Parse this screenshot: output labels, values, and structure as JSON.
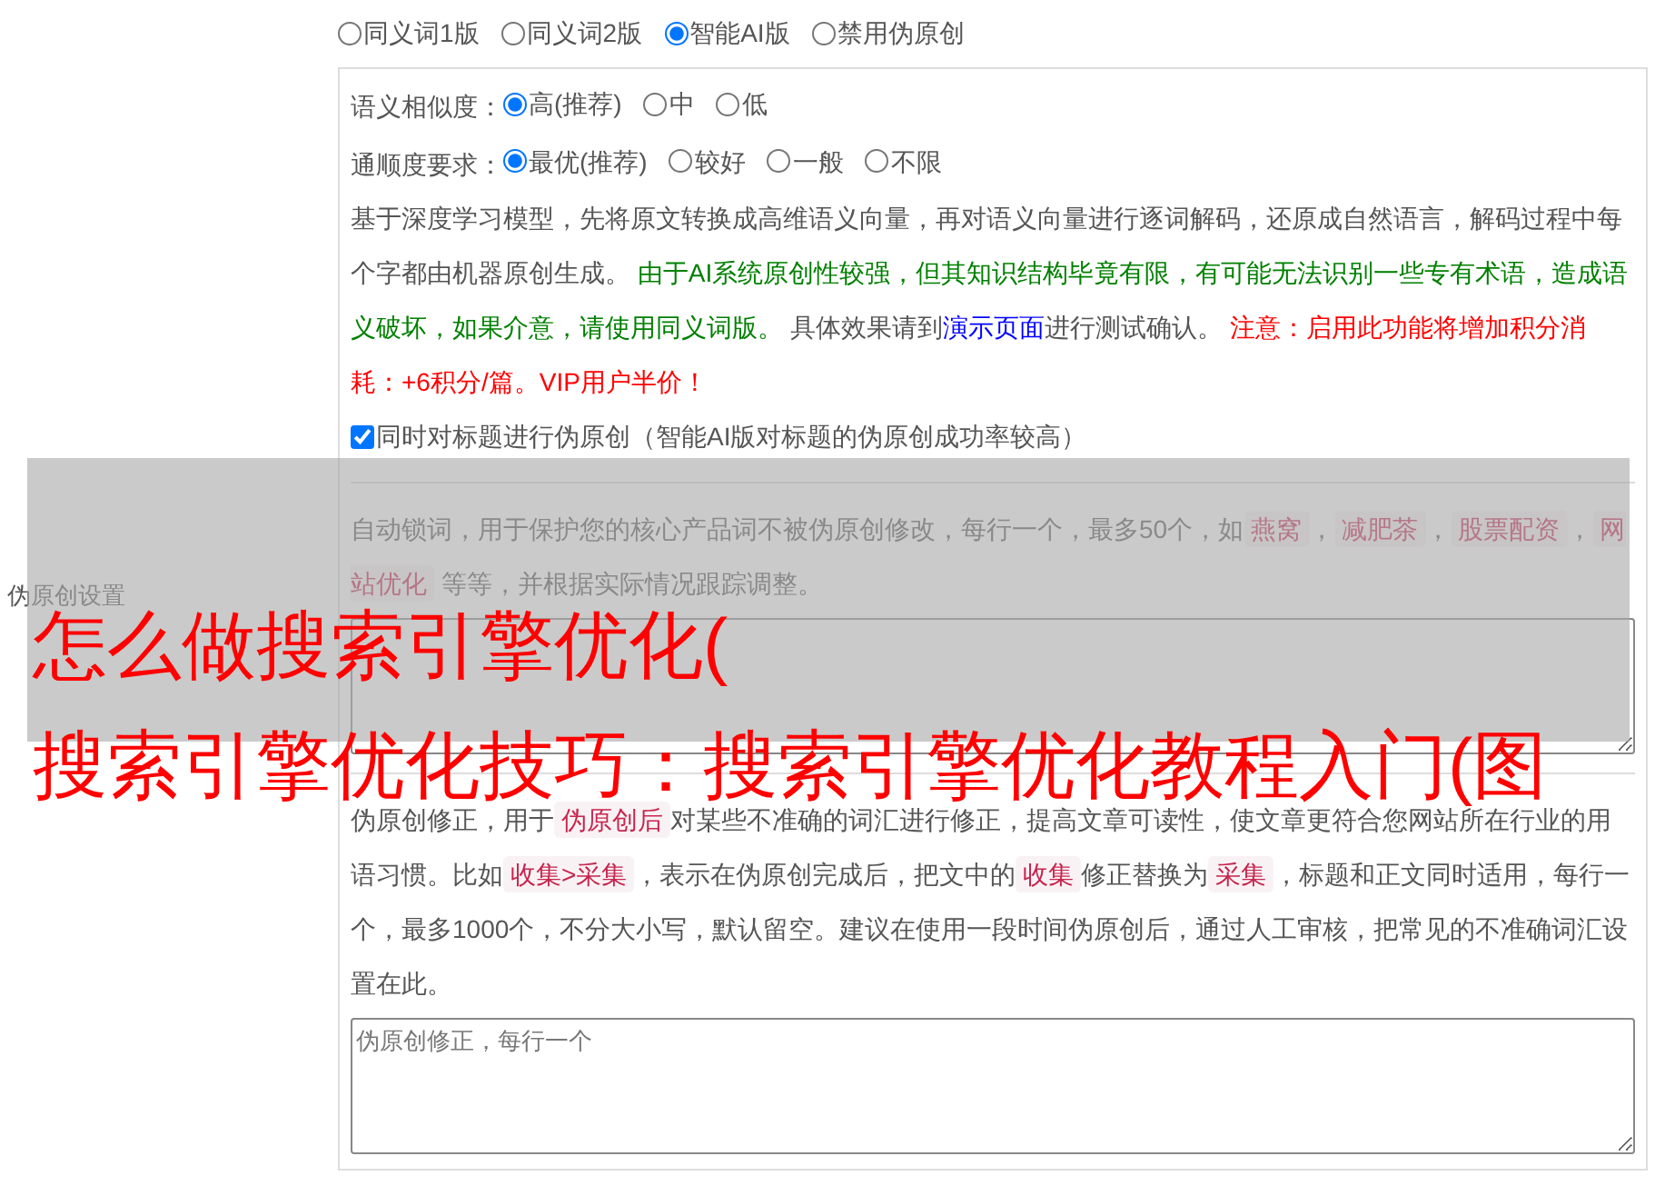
{
  "side_label": "伪原创设置",
  "mode_options": [
    {
      "label": "同义词1版",
      "selected": false
    },
    {
      "label": "同义词2版",
      "selected": false
    },
    {
      "label": "智能AI版",
      "selected": true
    },
    {
      "label": "禁用伪原创",
      "selected": false
    }
  ],
  "similarity": {
    "label": "语义相似度：",
    "options": [
      {
        "label": "高(推荐)",
        "selected": true
      },
      {
        "label": "中",
        "selected": false
      },
      {
        "label": "低",
        "selected": false
      }
    ]
  },
  "fluency": {
    "label": "通顺度要求：",
    "options": [
      {
        "label": "最优(推荐)",
        "selected": true
      },
      {
        "label": "较好",
        "selected": false
      },
      {
        "label": "一般",
        "selected": false
      },
      {
        "label": "不限",
        "selected": false
      }
    ]
  },
  "ai_description": [
    {
      "kind": "plain",
      "text": "基于深度学习模型，先将原文转换成高维语义向量，再对语义向量进行逐词解码，还原成自然语言，解码过程中每个字都由机器原创生成。 "
    },
    {
      "kind": "green",
      "text": "由于AI系统原创性较强，但其知识结构毕竟有限，有可能无法识别一些专有术语，造成语义破坏，如果介意，请使用同义词版。"
    },
    {
      "kind": "plain",
      "text": " 具体效果请到"
    },
    {
      "kind": "link",
      "text": "演示页面"
    },
    {
      "kind": "plain",
      "text": "进行测试确认。 "
    },
    {
      "kind": "red",
      "text": "注意：启用此功能将增加积分消耗：+6积分/篇。VIP用户半价！"
    }
  ],
  "title_checkbox": {
    "label": "同时对标题进行伪原创（智能AI版对标题的伪原创成功率较高）",
    "checked": true
  },
  "lock_words": {
    "description": [
      {
        "kind": "plain",
        "text": "自动锁词，用于保护您的核心产品词不被伪原创修改，每行一个，最多50个，如"
      },
      {
        "kind": "code",
        "text": "燕窝"
      },
      {
        "kind": "plain",
        "text": "，"
      },
      {
        "kind": "code",
        "text": "减肥茶"
      },
      {
        "kind": "plain",
        "text": "，"
      },
      {
        "kind": "code",
        "text": "股票配资"
      },
      {
        "kind": "plain",
        "text": "，"
      },
      {
        "kind": "code",
        "text": "网站优化"
      },
      {
        "kind": "plain",
        "text": " 等等，并根据实际情况跟踪调整。"
      }
    ]
  },
  "corrections": {
    "description": [
      {
        "kind": "plain",
        "text": "伪原创修正，用于"
      },
      {
        "kind": "code",
        "text": "伪原创后"
      },
      {
        "kind": "plain",
        "text": "对某些不准确的词汇进行修正，提高文章可读性，使文章更符合您网站所在行业的用语习惯。比如"
      },
      {
        "kind": "code",
        "text": "收集>采集"
      },
      {
        "kind": "plain",
        "text": "，表示在伪原创完成后，把文中的"
      },
      {
        "kind": "code",
        "text": "收集"
      },
      {
        "kind": "plain",
        "text": "修正替换为"
      },
      {
        "kind": "code",
        "text": "采集"
      },
      {
        "kind": "plain",
        "text": "，标题和正文同时适用，每行一个，最多1000个，不分大小写，默认留空。建议在使用一段时间伪原创后，通过人工审核，把常见的不准确词汇设置在此。"
      }
    ],
    "placeholder": "伪原创修正，每行一个"
  },
  "overlay_caption": [
    "怎么做搜索引擎优化(",
    "搜索引擎优化技巧：搜索引擎优化教程入门(图"
  ]
}
